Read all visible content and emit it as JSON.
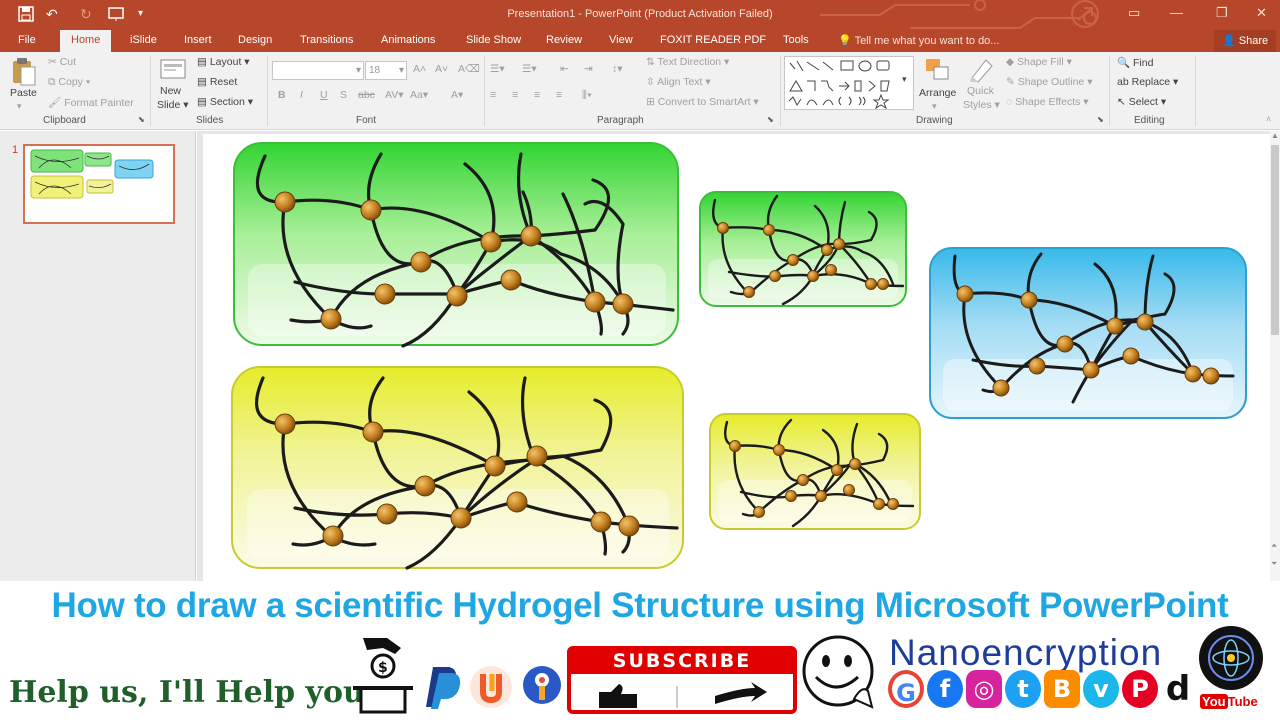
{
  "window": {
    "title": "Presentation1 - PowerPoint (Product Activation Failed)",
    "tell_me": "Tell me what you want to do...",
    "share": "Share"
  },
  "tabs": [
    "File",
    "Home",
    "iSlide",
    "Insert",
    "Design",
    "Transitions",
    "Animations",
    "Slide Show",
    "Review",
    "View",
    "FOXIT READER PDF",
    "Tools"
  ],
  "ribbon": {
    "clipboard": {
      "paste": "Paste",
      "cut": "Cut",
      "copy": "Copy",
      "format_painter": "Format Painter",
      "label": "Clipboard"
    },
    "slides": {
      "new_slide_1": "New",
      "new_slide_2": "Slide",
      "layout": "Layout",
      "reset": "Reset",
      "section": "Section",
      "label": "Slides"
    },
    "font": {
      "size": "18",
      "label": "Font"
    },
    "paragraph": {
      "text_direction": "Text Direction",
      "align_text": "Align Text",
      "convert": "Convert to SmartArt",
      "label": "Paragraph"
    },
    "drawing": {
      "arrange": "Arrange",
      "quick_styles_1": "Quick",
      "quick_styles_2": "Styles",
      "shape_fill": "Shape Fill",
      "shape_outline": "Shape Outline",
      "shape_effects": "Shape Effects",
      "label": "Drawing"
    },
    "editing": {
      "find": "Find",
      "replace": "Replace",
      "select": "Select",
      "label": "Editing"
    }
  },
  "slide_panel": {
    "number": "1"
  },
  "banner": {
    "title": "How to draw a scientific Hydrogel Structure using Microsoft PowerPoint",
    "help_text": "Help us, I'll Help you",
    "subscribe": "SUBSCRIBE",
    "brand": "Nanoencryption",
    "youtube": "You",
    "youtube_tube": "Tube"
  },
  "colors": {
    "accent": "#b7472a",
    "caption": "#1ea7e3",
    "help": "#1f5f2a",
    "brand": "#1d3c9b",
    "subscribe": "#e00000"
  },
  "slide_boxes": [
    {
      "color": "green"
    },
    {
      "color": "green"
    },
    {
      "color": "blue"
    },
    {
      "color": "yellow"
    },
    {
      "color": "yellow"
    }
  ]
}
